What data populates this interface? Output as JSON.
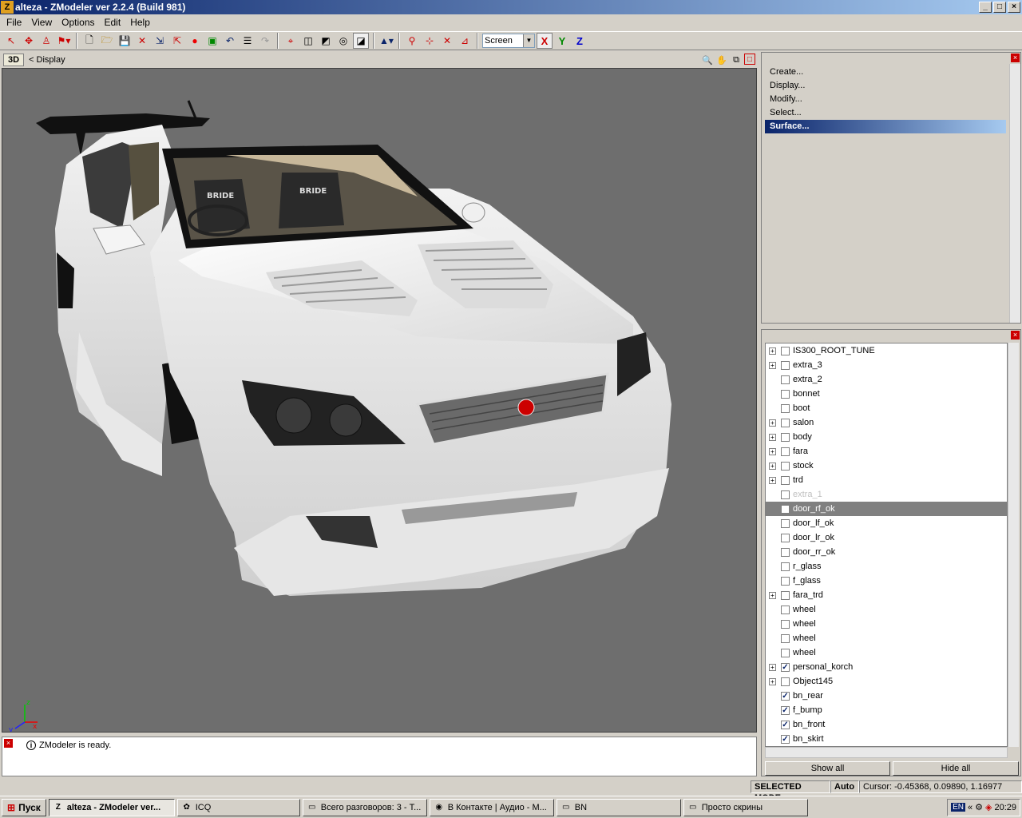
{
  "window": {
    "title": "alteza - ZModeler ver 2.2.4 (Build 981)",
    "app_icon": "Z"
  },
  "menu": [
    "File",
    "View",
    "Options",
    "Edit",
    "Help"
  ],
  "toolbar": {
    "coord_mode": "Screen",
    "axis_x": "X",
    "axis_y": "Y",
    "axis_z": "Z"
  },
  "viewport": {
    "mode_label": "3D",
    "path": "< Display",
    "axis_labels": {
      "x": "x",
      "y": "y",
      "z": "z"
    }
  },
  "commands": [
    "Create...",
    "Display...",
    "Modify...",
    "Select...",
    "Surface..."
  ],
  "tree": [
    {
      "label": "IS300_ROOT_TUNE",
      "expandable": true,
      "checked": false
    },
    {
      "label": "extra_3",
      "expandable": true,
      "checked": false
    },
    {
      "label": "extra_2",
      "expandable": false,
      "checked": false
    },
    {
      "label": "bonnet",
      "expandable": false,
      "checked": false
    },
    {
      "label": "boot",
      "expandable": false,
      "checked": false
    },
    {
      "label": "salon",
      "expandable": true,
      "checked": false
    },
    {
      "label": "body",
      "expandable": true,
      "checked": false
    },
    {
      "label": "fara",
      "expandable": true,
      "checked": false
    },
    {
      "label": "stock",
      "expandable": true,
      "checked": false
    },
    {
      "label": "trd",
      "expandable": true,
      "checked": false
    },
    {
      "label": "extra_1",
      "expandable": false,
      "checked": false,
      "ghost": true
    },
    {
      "label": "door_rf_ok",
      "expandable": false,
      "checked": false,
      "selected": true
    },
    {
      "label": "door_lf_ok",
      "expandable": false,
      "checked": false
    },
    {
      "label": "door_lr_ok",
      "expandable": false,
      "checked": false
    },
    {
      "label": "door_rr_ok",
      "expandable": false,
      "checked": false
    },
    {
      "label": "r_glass",
      "expandable": false,
      "checked": false
    },
    {
      "label": "f_glass",
      "expandable": false,
      "checked": false
    },
    {
      "label": "fara_trd",
      "expandable": true,
      "checked": false
    },
    {
      "label": "wheel",
      "expandable": false,
      "checked": false
    },
    {
      "label": "wheel",
      "expandable": false,
      "checked": false
    },
    {
      "label": "wheel",
      "expandable": false,
      "checked": false
    },
    {
      "label": "wheel",
      "expandable": false,
      "checked": false
    },
    {
      "label": "personal_korch",
      "expandable": true,
      "checked": true
    },
    {
      "label": "Object145",
      "expandable": true,
      "checked": false
    },
    {
      "label": "bn_rear",
      "expandable": false,
      "checked": true
    },
    {
      "label": "f_bump",
      "expandable": false,
      "checked": true
    },
    {
      "label": "bn_front",
      "expandable": false,
      "checked": true
    },
    {
      "label": "bn_skirt",
      "expandable": false,
      "checked": true
    }
  ],
  "buttons": {
    "show_all": "Show all",
    "hide_all": "Hide all"
  },
  "log": {
    "message": "ZModeler is ready."
  },
  "status": {
    "mode": "SELECTED MODE",
    "auto": "Auto",
    "cursor": "Cursor: -0.45368, 0.09890, 1.16977"
  },
  "taskbar": {
    "start": "Пуск",
    "tasks": [
      {
        "label": "alteza - ZModeler ver...",
        "active": true,
        "icon": "Z"
      },
      {
        "label": "ICQ",
        "active": false,
        "icon": "✿"
      },
      {
        "label": "Всего разговоров: 3 - T...",
        "active": false,
        "icon": "▭"
      },
      {
        "label": "В Контакте | Аудио - M...",
        "active": false,
        "icon": "◉"
      },
      {
        "label": "BN",
        "active": false,
        "icon": "▭"
      },
      {
        "label": "Просто скрины",
        "active": false,
        "icon": "▭"
      }
    ],
    "lang": "EN",
    "clock": "20:29"
  },
  "car_badges": {
    "seat_left": "BRIDE",
    "seat_right": "BRIDE"
  }
}
